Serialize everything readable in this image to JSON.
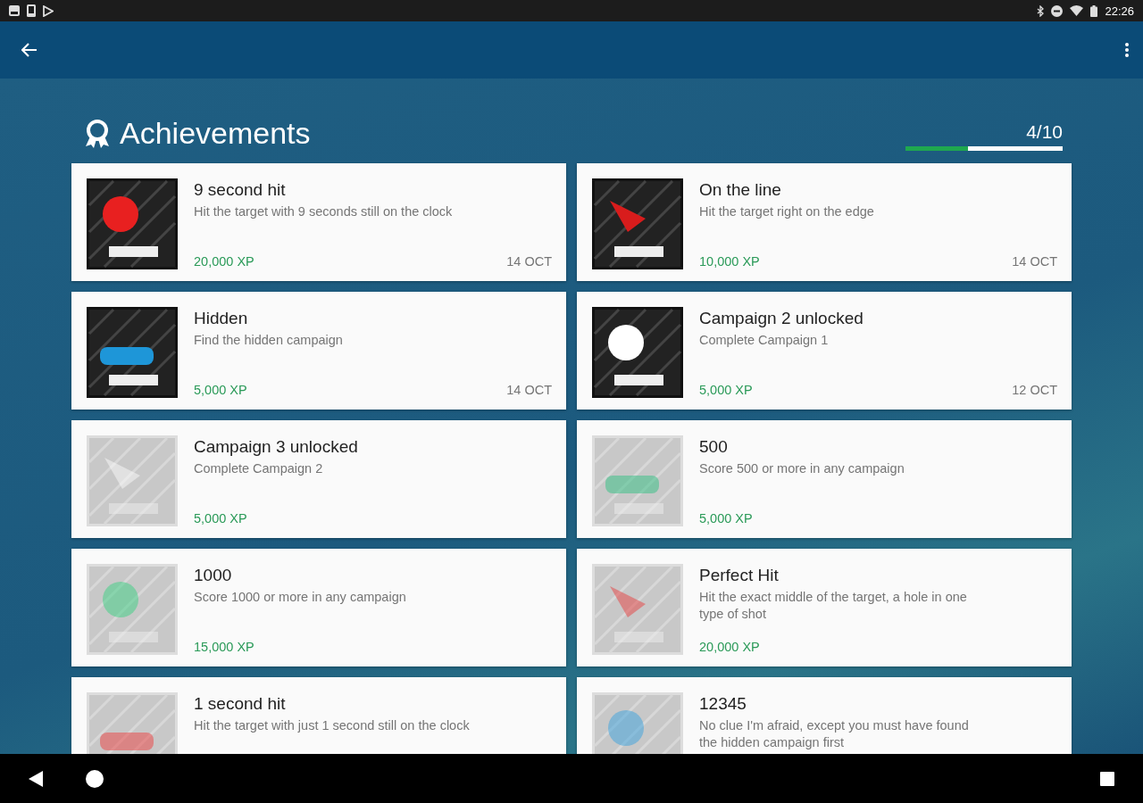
{
  "status_bar": {
    "time": "22:26"
  },
  "header": {
    "title": "Achievements",
    "progress_text": "4/10",
    "level": 0.4
  },
  "achievements": [
    {
      "title": "9 second hit",
      "description": "Hit the target with 9 seconds still on the clock",
      "xp": "20,000 XP",
      "date": "14 OCT",
      "unlocked": true
    },
    {
      "title": "On the line",
      "description": "Hit the target right on the edge",
      "xp": "10,000 XP",
      "date": "14 OCT",
      "unlocked": true
    },
    {
      "title": "Hidden",
      "description": "Find the hidden campaign",
      "xp": "5,000 XP",
      "date": "14 OCT",
      "unlocked": true
    },
    {
      "title": "Campaign 2 unlocked",
      "description": "Complete Campaign 1",
      "xp": "5,000 XP",
      "date": "12 OCT",
      "unlocked": true
    },
    {
      "title": "Campaign 3 unlocked",
      "description": "Complete Campaign 2",
      "xp": "5,000 XP",
      "unlocked": false
    },
    {
      "title": "500",
      "description": "Score 500 or more in any campaign",
      "xp": "5,000 XP",
      "unlocked": false
    },
    {
      "title": "1000",
      "description": "Score 1000 or more in any campaign",
      "xp": "15,000 XP",
      "unlocked": false
    },
    {
      "title": "Perfect Hit",
      "description": "Hit the exact middle of the target, a hole in one type of shot",
      "xp": "20,000 XP",
      "unlocked": false
    },
    {
      "title": "1 second hit",
      "description": "Hit the target with just 1 second still on the clock",
      "unlocked": false
    },
    {
      "title": "12345",
      "description": "No clue I'm afraid, except you must have found the hidden campaign first",
      "unlocked": false
    }
  ]
}
